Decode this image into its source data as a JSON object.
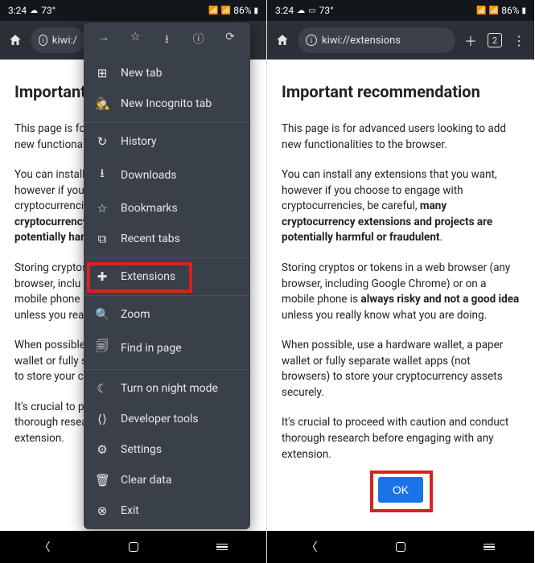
{
  "status": {
    "time": "3:24",
    "temp": "73°",
    "battery": "86%"
  },
  "toolbarLeft": {
    "url": "kiwi:/"
  },
  "toolbarRight": {
    "url": "kiwi://extensions",
    "tabCount": "2"
  },
  "menu": {
    "items": [
      {
        "icon": "⊞",
        "label": "New tab"
      },
      {
        "icon": "🕵",
        "label": "New Incognito tab"
      },
      {
        "icon": "↻",
        "label": "History"
      },
      {
        "icon": "⭳",
        "label": "Downloads"
      },
      {
        "icon": "☆",
        "label": "Bookmarks"
      },
      {
        "icon": "⧉",
        "label": "Recent tabs"
      },
      {
        "icon": "✚",
        "label": "Extensions"
      },
      {
        "icon": "🔍",
        "label": "Zoom"
      },
      {
        "icon": "🗐",
        "label": "Find in page"
      },
      {
        "icon": "☾",
        "label": "Turn on night mode"
      },
      {
        "icon": "⟨⟩",
        "label": "Developer tools"
      },
      {
        "icon": "⚙",
        "label": "Settings"
      },
      {
        "icon": "🗑",
        "label": "Clear data"
      },
      {
        "icon": "⊗",
        "label": "Exit"
      }
    ]
  },
  "page": {
    "title": "Important recommendation",
    "p1": "This page is for advanced users looking to add new functionalities to the browser.",
    "p2a": "You can install any extensions that you want, however if you choose to engage with cryptocurrencies, be careful, ",
    "p2b": "many cryptocurrency extensions and projects are potentially harmful or fraudulent",
    "p2c": ".",
    "p3a": "Storing cryptos or tokens in a web browser (any browser, including Google Chrome) or on a mobile phone is ",
    "p3b": "always risky and not a good idea",
    "p3c": " unless you really know what you are doing.",
    "p4": "When possible, use a hardware wallet, a paper wallet or fully separate wallet apps (not browsers) to store your cryptocurrency assets securely.",
    "p5": "It's crucial to proceed with caution and conduct thorough research before engaging with any extension.",
    "okLabel": "OK"
  },
  "pageLeft": {
    "title": "Important",
    "l1": "This page is fo",
    "l2": "new functional",
    "l3": "You can install",
    "l4": "however if you",
    "l5": "cryptocurrenci",
    "l6": "cryptocurrency",
    "l7": "potentially har",
    "l8": "Storing cryptos",
    "l9": "browser, inclu",
    "l10": "mobile phone",
    "l11": "unless you rea",
    "l12": "When possible",
    "l13": "wallet or fully s",
    "l14": "to store your c",
    "l15": "It's crucial to p",
    "l16": "thorough resea",
    "l17": "extension."
  }
}
